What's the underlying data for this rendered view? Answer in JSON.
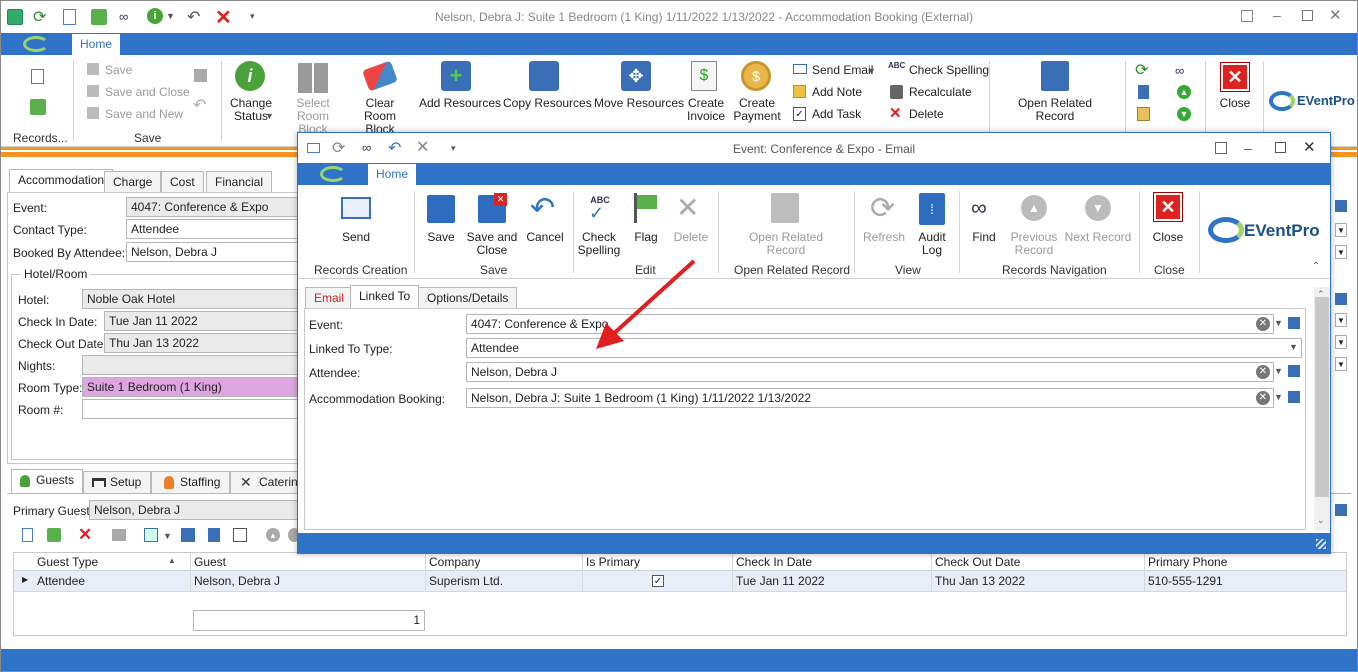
{
  "main": {
    "title": "Nelson, Debra J: Suite 1 Bedroom (1 King) 1/11/2022 1/13/2022  - Accommodation Booking (External)",
    "home_tab": "Home",
    "ribbon": {
      "save": "Save",
      "save_close": "Save and Close",
      "save_new": "Save and New",
      "change_status": "Change\nStatus",
      "select_room_block": "Select\nRoom Block",
      "clear_room_block": "Clear Room\nBlock",
      "add_resources": "Add Resources",
      "copy_resources": "Copy Resources",
      "move_resources": "Move Resources",
      "create_invoice": "Create\nInvoice",
      "create_payment": "Create\nPayment",
      "send_email": "Send Email",
      "add_note": "Add Note",
      "add_task": "Add Task",
      "check_spelling": "Check Spelling",
      "recalculate": "Recalculate",
      "delete": "Delete",
      "open_related_record": "Open Related\nRecord",
      "close": "Close",
      "group_records": "Records...",
      "group_save": "Save"
    },
    "tabs": [
      "Accommodation",
      "Charge",
      "Cost",
      "Financial"
    ],
    "form": {
      "event_label": "Event:",
      "event_value": "4047: Conference & Expo",
      "contact_type_label": "Contact Type:",
      "contact_type_value": "Attendee",
      "booked_by_label": "Booked By Attendee:*",
      "booked_by_value": "Nelson, Debra J",
      "hotel_room_group": "Hotel/Room",
      "hotel_label": "Hotel:",
      "hotel_value": "Noble Oak Hotel",
      "checkin_label": "Check In Date:",
      "checkin_value": "Tue Jan 11 2022",
      "checkout_label": "Check Out Date:",
      "checkout_value": "Thu Jan 13 2022",
      "nights_label": "Nights:",
      "nights_value": "",
      "roomtype_label": "Room Type:",
      "roomtype_value": "Suite 1 Bedroom (1 King)",
      "roomnum_label": "Room #:",
      "roomnum_value": ""
    },
    "bottom_tabs": [
      "Guests",
      "Setup",
      "Staffing",
      "Catering"
    ],
    "primary_guest_label": "Primary Guest:",
    "primary_guest_value": "Nelson, Debra J",
    "grid": {
      "columns": [
        "Guest Type",
        "Guest",
        "Company",
        "Is Primary",
        "Check In Date",
        "Check Out Date",
        "Primary Phone"
      ],
      "rows": [
        [
          "Attendee",
          "Nelson, Debra J",
          "Superism Ltd.",
          "",
          "Tue Jan 11 2022",
          "Thu Jan 13 2022",
          "510-555-1291"
        ]
      ],
      "count": "1"
    }
  },
  "dialog": {
    "title": "Event: Conference & Expo - Email",
    "home_tab": "Home",
    "ribbon": {
      "send": "Send",
      "save": "Save",
      "save_close": "Save and\nClose",
      "cancel": "Cancel",
      "check_spelling": "Check\nSpelling",
      "flag": "Flag",
      "delete": "Delete",
      "open_related_record": "Open Related\nRecord",
      "refresh": "Refresh",
      "audit_log": "Audit\nLog",
      "find": "Find",
      "previous_record": "Previous\nRecord",
      "next_record": "Next Record",
      "close": "Close",
      "groups": [
        "Records Creation",
        "Save",
        "Edit",
        "Open Related Record",
        "View",
        "Records Navigation",
        "Close"
      ]
    },
    "tabs": [
      "Email",
      "Linked To",
      "Options/Details"
    ],
    "fields": {
      "event_label": "Event:",
      "event_value": "4047: Conference & Expo",
      "linked_type_label": "Linked To Type:",
      "linked_type_value": "Attendee",
      "attendee_label": "Attendee:",
      "attendee_value": "Nelson, Debra J",
      "booking_label": "Accommodation Booking:",
      "booking_value": "Nelson, Debra J: Suite 1 Bedroom (1 King) 1/11/2022 1/13/2022"
    }
  },
  "brand": "EVentPro",
  "colors": {
    "accent": "#2e73c7",
    "orange": "#f7941d",
    "room_type_bg": "#dea6e0",
    "arrow": "#e02020"
  }
}
